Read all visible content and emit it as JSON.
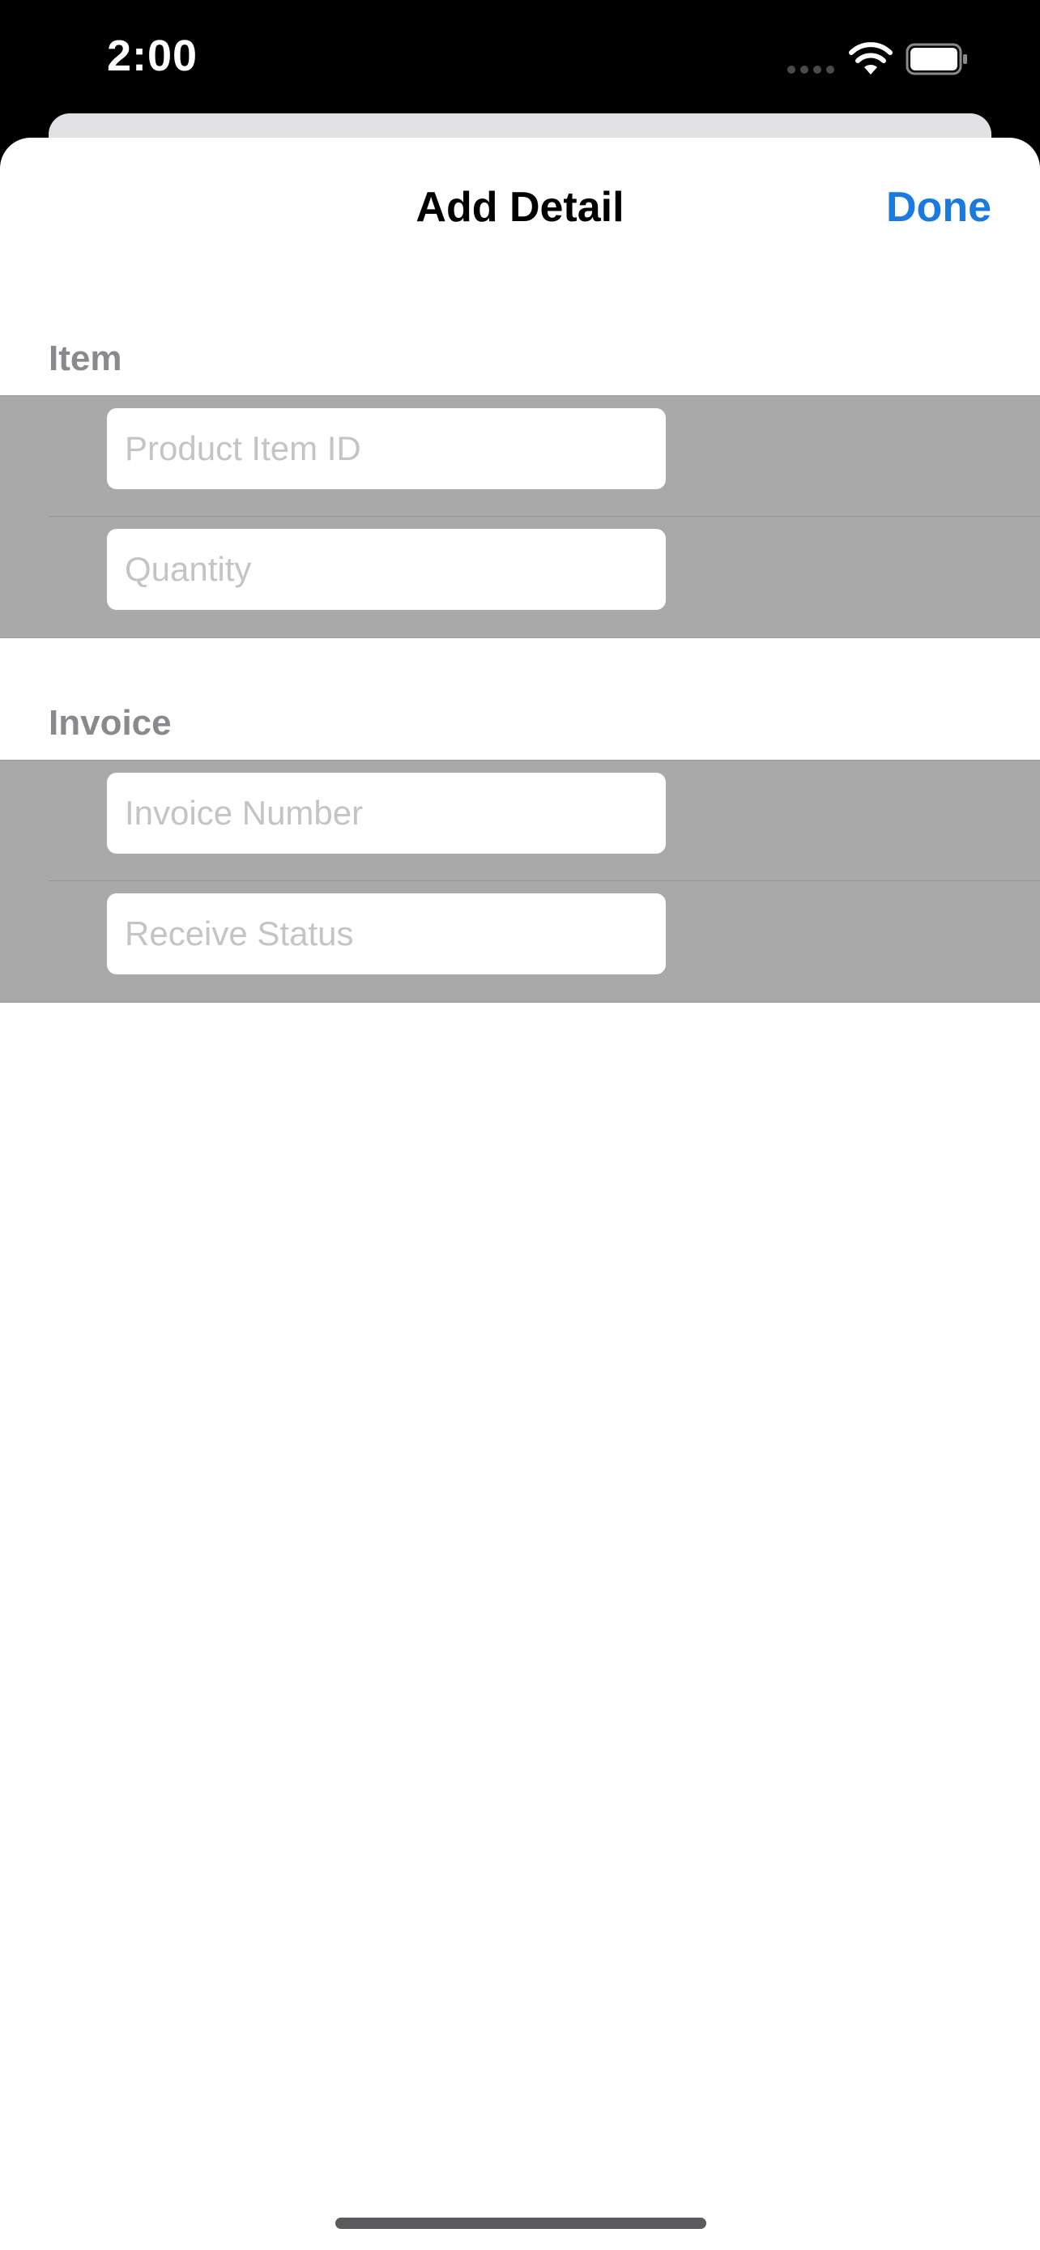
{
  "status_bar": {
    "time": "2:00",
    "icons": [
      "cellular-signal-icon",
      "wifi-icon",
      "battery-icon"
    ]
  },
  "navigation": {
    "title": "Add Detail",
    "done_label": "Done"
  },
  "sections": {
    "item": {
      "header": "Item",
      "fields": {
        "product_item_id": {
          "placeholder": "Product Item ID",
          "value": ""
        },
        "quantity": {
          "placeholder": "Quantity",
          "value": ""
        }
      }
    },
    "invoice": {
      "header": "Invoice",
      "fields": {
        "invoice_number": {
          "placeholder": "Invoice Number",
          "value": ""
        },
        "receive_status": {
          "placeholder": "Receive Status",
          "value": ""
        }
      }
    }
  },
  "colors": {
    "accent": "#1a7ae0",
    "section_background": "#a9a9a9",
    "section_header_text": "#8a8a8e",
    "placeholder_text": "#c4c4c7"
  }
}
